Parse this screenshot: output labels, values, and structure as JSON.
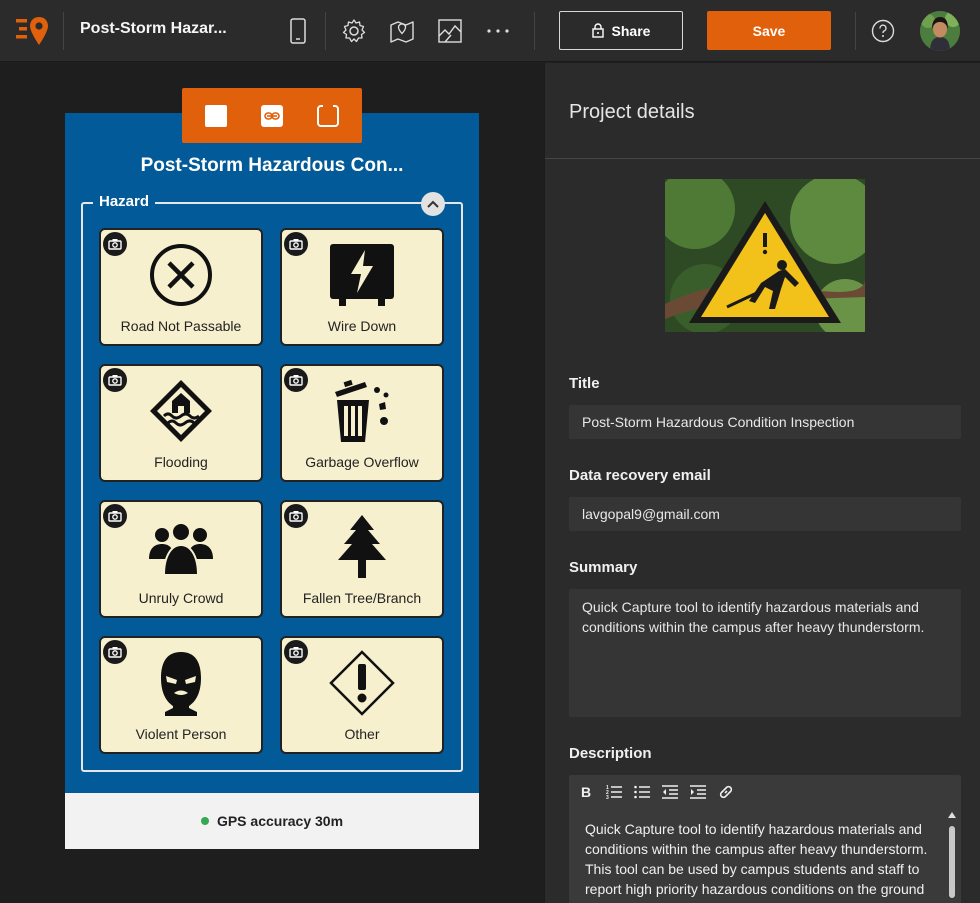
{
  "header": {
    "app_title": "Post-Storm Hazar...",
    "share_label": "Share",
    "save_label": "Save",
    "icons": [
      "logo-icon",
      "mobile-preview-icon",
      "settings-icon",
      "map-icon",
      "layout-icon",
      "more-icon",
      "help-icon"
    ]
  },
  "preview": {
    "title": "Post-Storm Hazardous Con...",
    "group_label": "Hazard",
    "tiles": [
      {
        "label": "Road Not Passable",
        "icon": "no-entry-icon"
      },
      {
        "label": "Wire Down",
        "icon": "electric-box-icon"
      },
      {
        "label": "Flooding",
        "icon": "flood-icon"
      },
      {
        "label": "Garbage Overflow",
        "icon": "trash-icon"
      },
      {
        "label": "Unruly Crowd",
        "icon": "crowd-icon"
      },
      {
        "label": "Fallen Tree/Branch",
        "icon": "tree-icon"
      },
      {
        "label": "Violent Person",
        "icon": "masked-person-icon"
      },
      {
        "label": "Other",
        "icon": "warning-diamond-icon"
      }
    ],
    "gps_text": "GPS accuracy 30m"
  },
  "details": {
    "heading": "Project details",
    "title_label": "Title",
    "title_value": "Post-Storm Hazardous Condition Inspection",
    "email_label": "Data recovery email",
    "email_value": "lavgopal9@gmail.com",
    "summary_label": "Summary",
    "summary_value": "Quick Capture tool to identify hazardous materials and conditions within the campus after heavy thunderstorm.",
    "description_label": "Description",
    "description_value": "Quick Capture tool to identify hazardous materials and conditions within the campus after heavy thunderstorm. This tool can be used by campus students and staff to report high priority hazardous conditions on the ground within the Storrs campus following a storm."
  },
  "colors": {
    "accent": "#e0600b",
    "phone_bg": "#025b98",
    "tile_bg": "#f7f0cf"
  }
}
